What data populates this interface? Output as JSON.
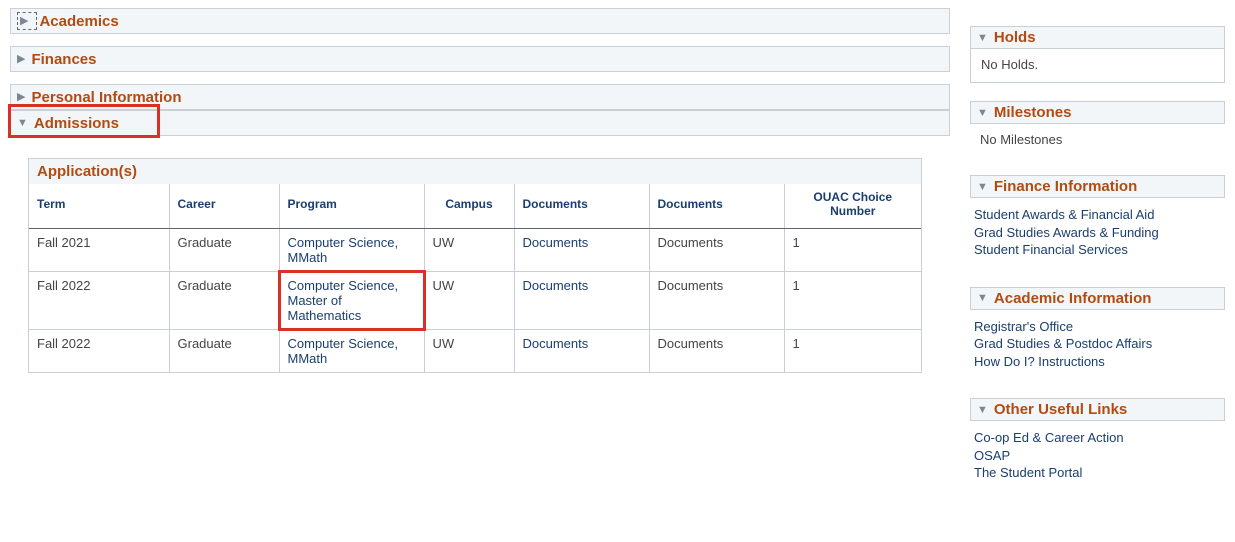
{
  "sections": {
    "academics": "Academics",
    "finances": "Finances",
    "personal": "Personal Information",
    "admissions": "Admissions"
  },
  "applications": {
    "title": "Application(s)",
    "headers": {
      "term": "Term",
      "career": "Career",
      "program": "Program",
      "campus": "Campus",
      "documents1": "Documents",
      "documents2": "Documents",
      "ouac": "OUAC Choice Number"
    },
    "rows": [
      {
        "term": "Fall 2021",
        "career": "Graduate",
        "program": "Computer Science, MMath",
        "campus": "UW",
        "docLink": "Documents",
        "docText": "Documents",
        "ouac": "1"
      },
      {
        "term": "Fall 2022",
        "career": "Graduate",
        "program": "Computer Science, Master of Mathematics",
        "campus": "UW",
        "docLink": "Documents",
        "docText": "Documents",
        "ouac": "1"
      },
      {
        "term": "Fall 2022",
        "career": "Graduate",
        "program": "Computer Science, MMath",
        "campus": "UW",
        "docLink": "Documents",
        "docText": "Documents",
        "ouac": "1"
      }
    ]
  },
  "sidebar": {
    "holds": {
      "title": "Holds",
      "body": "No Holds."
    },
    "milestones": {
      "title": "Milestones",
      "body": "No Milestones"
    },
    "finance": {
      "title": "Finance Information",
      "links": [
        "Student Awards & Financial Aid",
        "Grad Studies Awards & Funding",
        "Student Financial Services"
      ]
    },
    "academic": {
      "title": "Academic Information",
      "links": [
        "Registrar's Office",
        "Grad Studies & Postdoc Affairs",
        "How Do I? Instructions"
      ]
    },
    "other": {
      "title": "Other Useful Links",
      "links": [
        "Co-op Ed & Career Action",
        "OSAP",
        "The Student Portal"
      ]
    }
  }
}
